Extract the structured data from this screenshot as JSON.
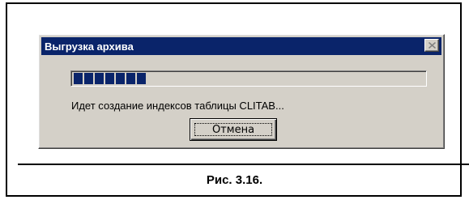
{
  "dialog": {
    "title": "Выгрузка архива",
    "close_icon": "close-icon",
    "progress": {
      "filled_blocks": 7
    },
    "status_text": "Идет создание индексов таблицы CLITAB...",
    "cancel_label": "Отмена"
  },
  "figure": {
    "caption": "Рис. 3.16."
  },
  "colors": {
    "titlebar": "#0a246a",
    "dialog_face": "#d4d0c8",
    "progress_block": "#0a246a"
  }
}
